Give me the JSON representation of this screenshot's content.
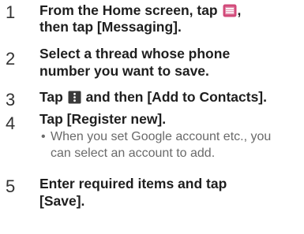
{
  "colors": {
    "text": "#1e1e1e",
    "number": "#333333",
    "note": "#6a6a6a",
    "menu_icon": "#d24a7a",
    "options_icon": "#3a3a3a"
  },
  "icons": {
    "menu": "menu-key-icon",
    "options": "options-key-icon"
  },
  "steps": [
    {
      "number": "1",
      "line1_before": "From the Home screen, tap",
      "line1_after": ",",
      "line2": "then tap [Messaging]."
    },
    {
      "number": "2",
      "line1": "Select a thread whose phone",
      "line2": "number you want to save."
    },
    {
      "number": "3",
      "line1_before": "Tap",
      "line1_after": "and then [Add to Contacts]."
    },
    {
      "number": "4",
      "line1": "Tap [Register new].",
      "note_bullet": "•",
      "note_line1": "When you set Google account etc., you",
      "note_line2": "can select an account to add."
    },
    {
      "number": "5",
      "line1": "Enter required items and tap",
      "line2": "[Save]."
    }
  ]
}
